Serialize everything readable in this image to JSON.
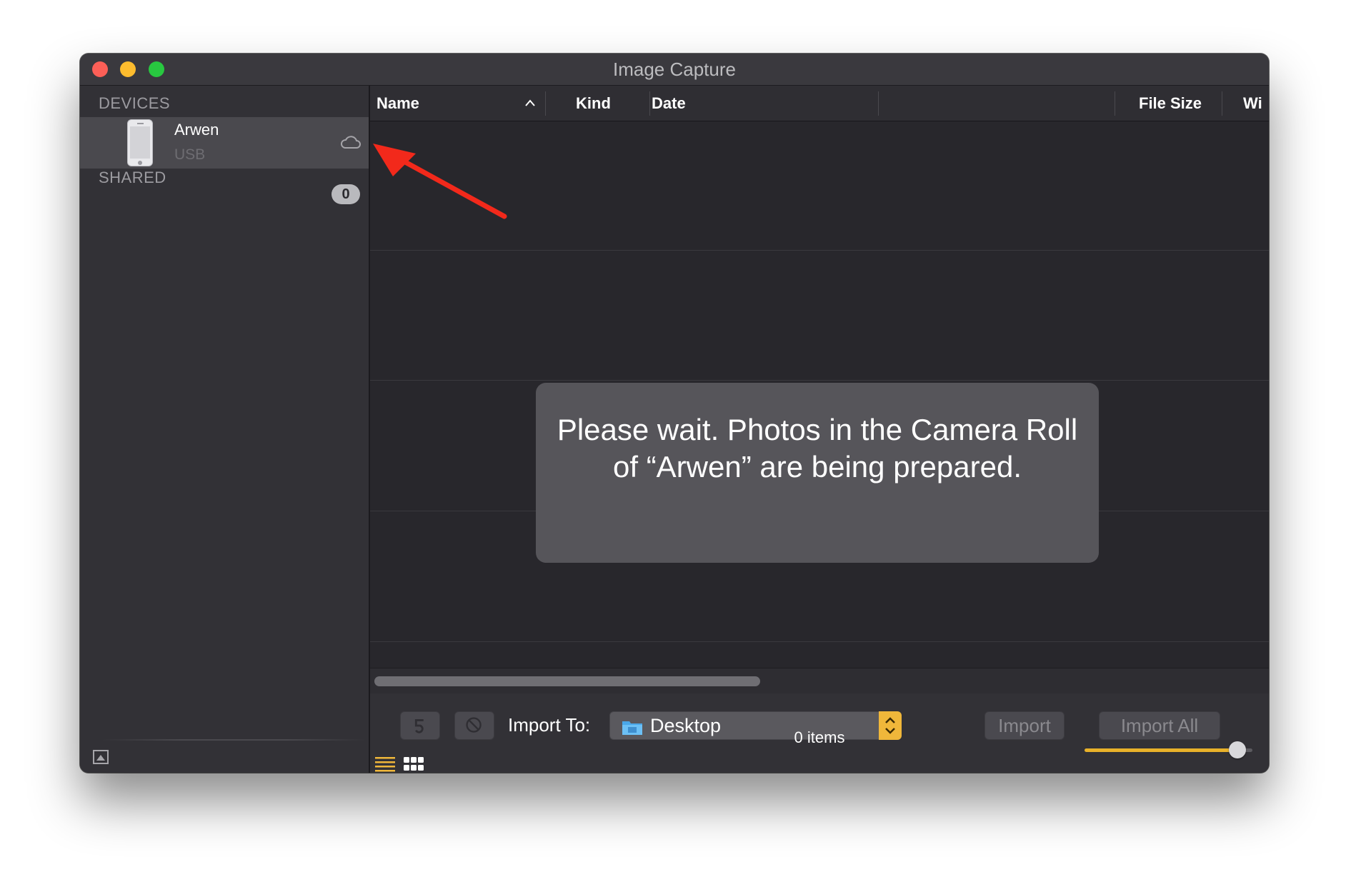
{
  "window": {
    "title": "Image Capture"
  },
  "sidebar": {
    "devices_label": "DEVICES",
    "device": {
      "name": "Arwen",
      "connection": "USB"
    },
    "shared_label": "SHARED",
    "shared_count": "0"
  },
  "columns": [
    {
      "label": "Name"
    },
    {
      "label": "Kind"
    },
    {
      "label": "Date"
    },
    {
      "label": "File Size"
    },
    {
      "label": "Wi"
    }
  ],
  "toast": {
    "message": "Please wait. Photos in the Camera Roll of “Arwen” are being prepared."
  },
  "bottom": {
    "import_to_label": "Import To:",
    "destination": "Desktop",
    "import_label": "Import",
    "import_all_label": "Import All",
    "items_count": "0 items",
    "thumbnail_size_fraction": 0.9
  },
  "colors": {
    "accent": "#f0b73a",
    "annotation_arrow": "#f2291b"
  }
}
